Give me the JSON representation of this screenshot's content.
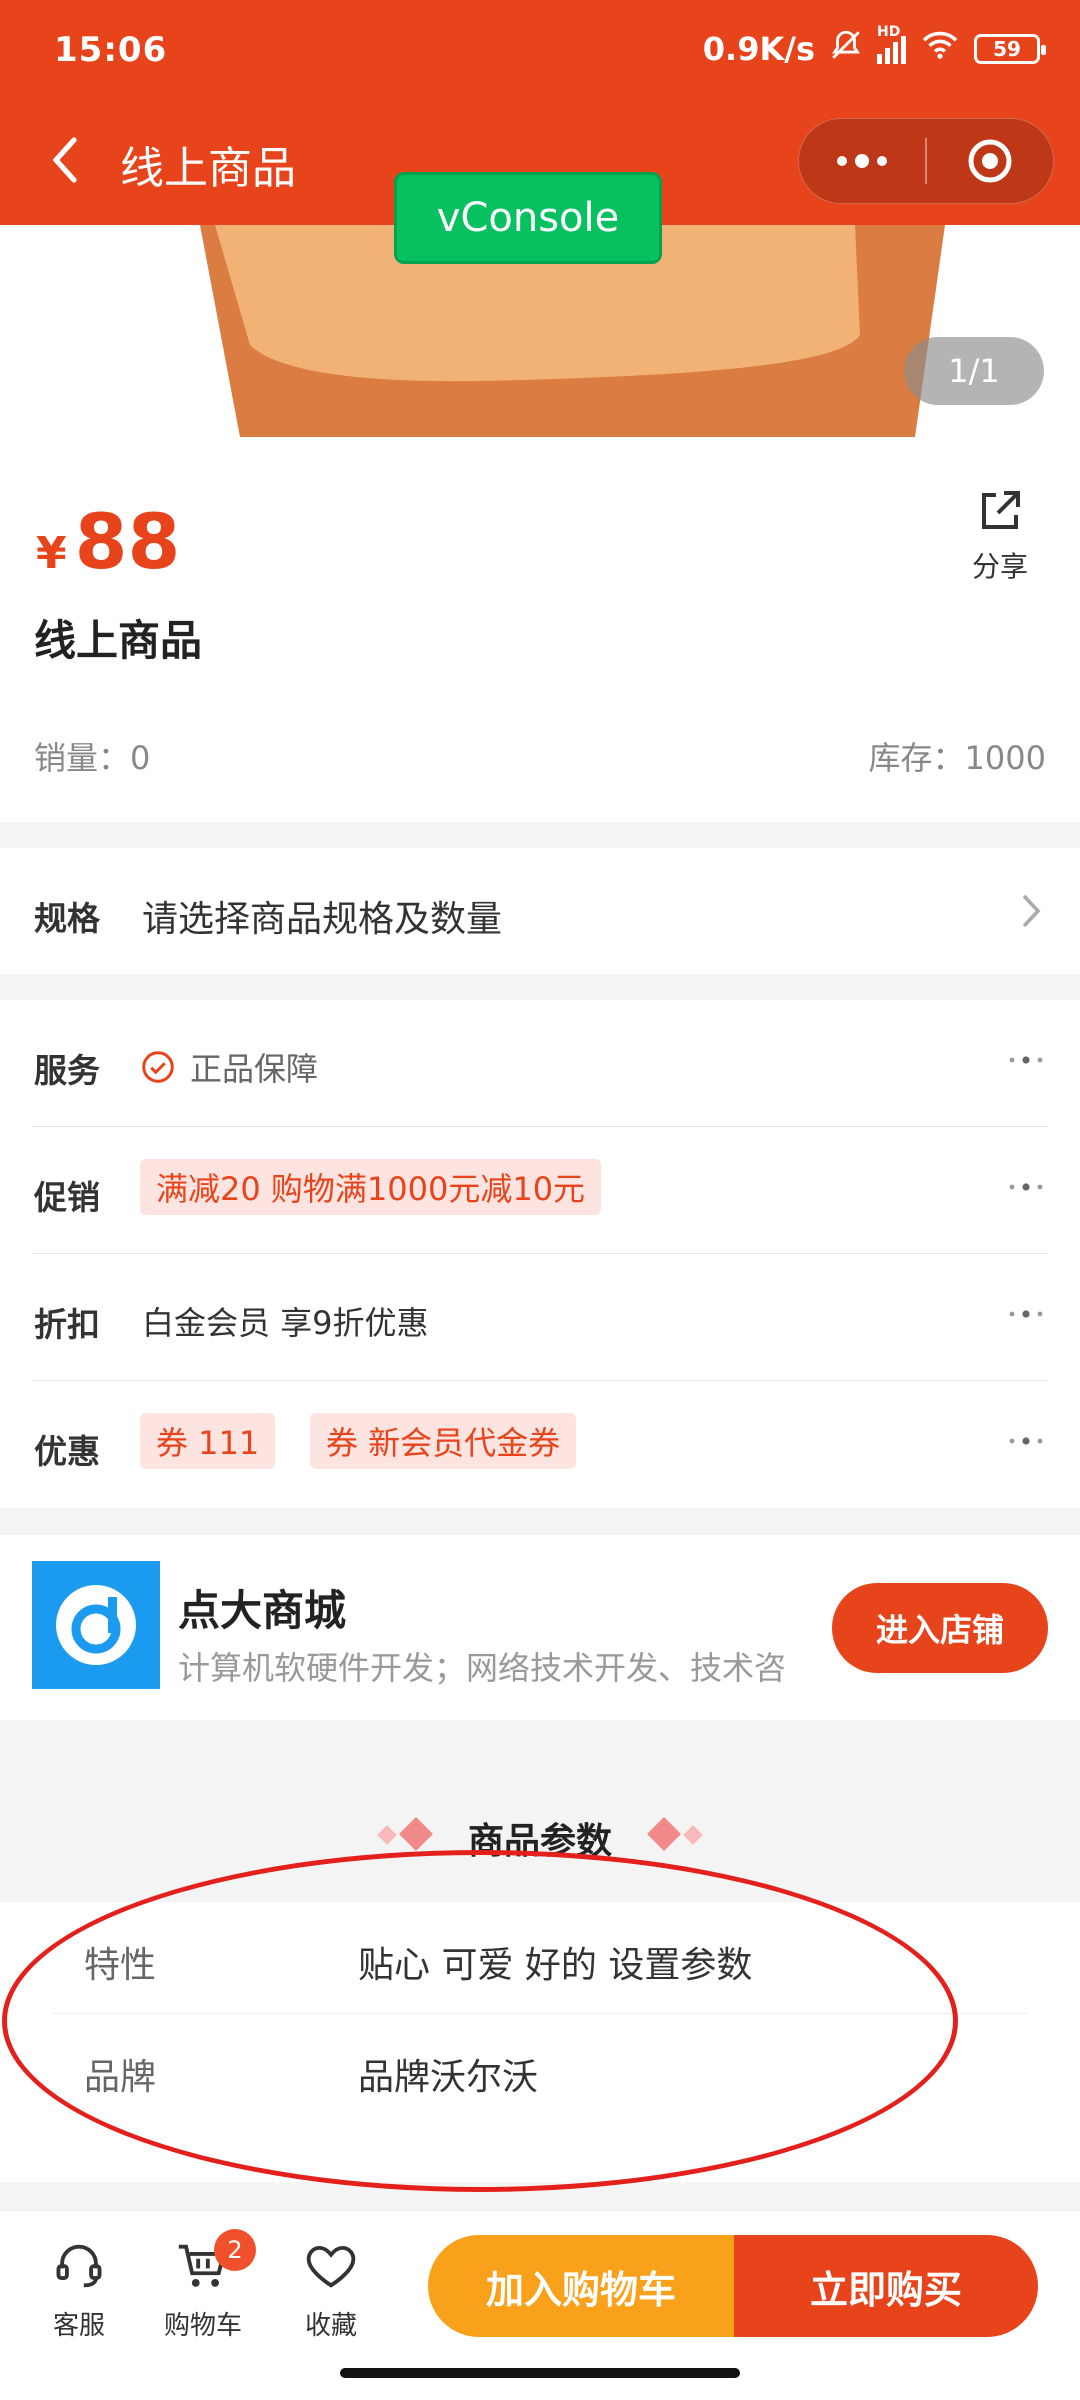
{
  "status_bar": {
    "time": "15:06",
    "net_speed": "0.9K/s",
    "battery": "59",
    "hd": "HD"
  },
  "nav": {
    "title": "线上商品"
  },
  "vconsole": {
    "label": "vConsole"
  },
  "gallery": {
    "indicator": "1/1"
  },
  "product": {
    "currency": "¥",
    "price": "88",
    "share_label": "分享",
    "title": "线上商品",
    "sales": "销量：0",
    "stock": "库存：1000"
  },
  "spec": {
    "key": "规格",
    "value": "请选择商品规格及数量"
  },
  "service": {
    "rows": [
      {
        "key": "服务",
        "value": "正品保障"
      },
      {
        "key": "促销",
        "tag": "满减20   购物满1000元减10元"
      },
      {
        "key": "折扣",
        "value": "白金会员 享9折优惠"
      },
      {
        "key": "优惠",
        "tags": [
          "券   111",
          "券   新会员代金券"
        ]
      }
    ]
  },
  "shop": {
    "name": "点大商城",
    "desc": "计算机软硬件开发；网络技术开发、技术咨",
    "enter_label": "进入店铺"
  },
  "params": {
    "title": "商品参数",
    "rows": [
      {
        "key": "特性",
        "value": "贴心 可爱 好的 设置参数"
      },
      {
        "key": "品牌",
        "value": "品牌沃尔沃"
      }
    ]
  },
  "bottom_bar": {
    "service_label": "客服",
    "cart_label": "购物车",
    "cart_badge": "2",
    "fav_label": "收藏",
    "add_cart": "加入购物车",
    "buy_now": "立即购买"
  },
  "colors": {
    "brand": "#e8441c",
    "orange": "#f9a11b",
    "vconsole": "#07c160",
    "annotation": "#e3201b"
  }
}
